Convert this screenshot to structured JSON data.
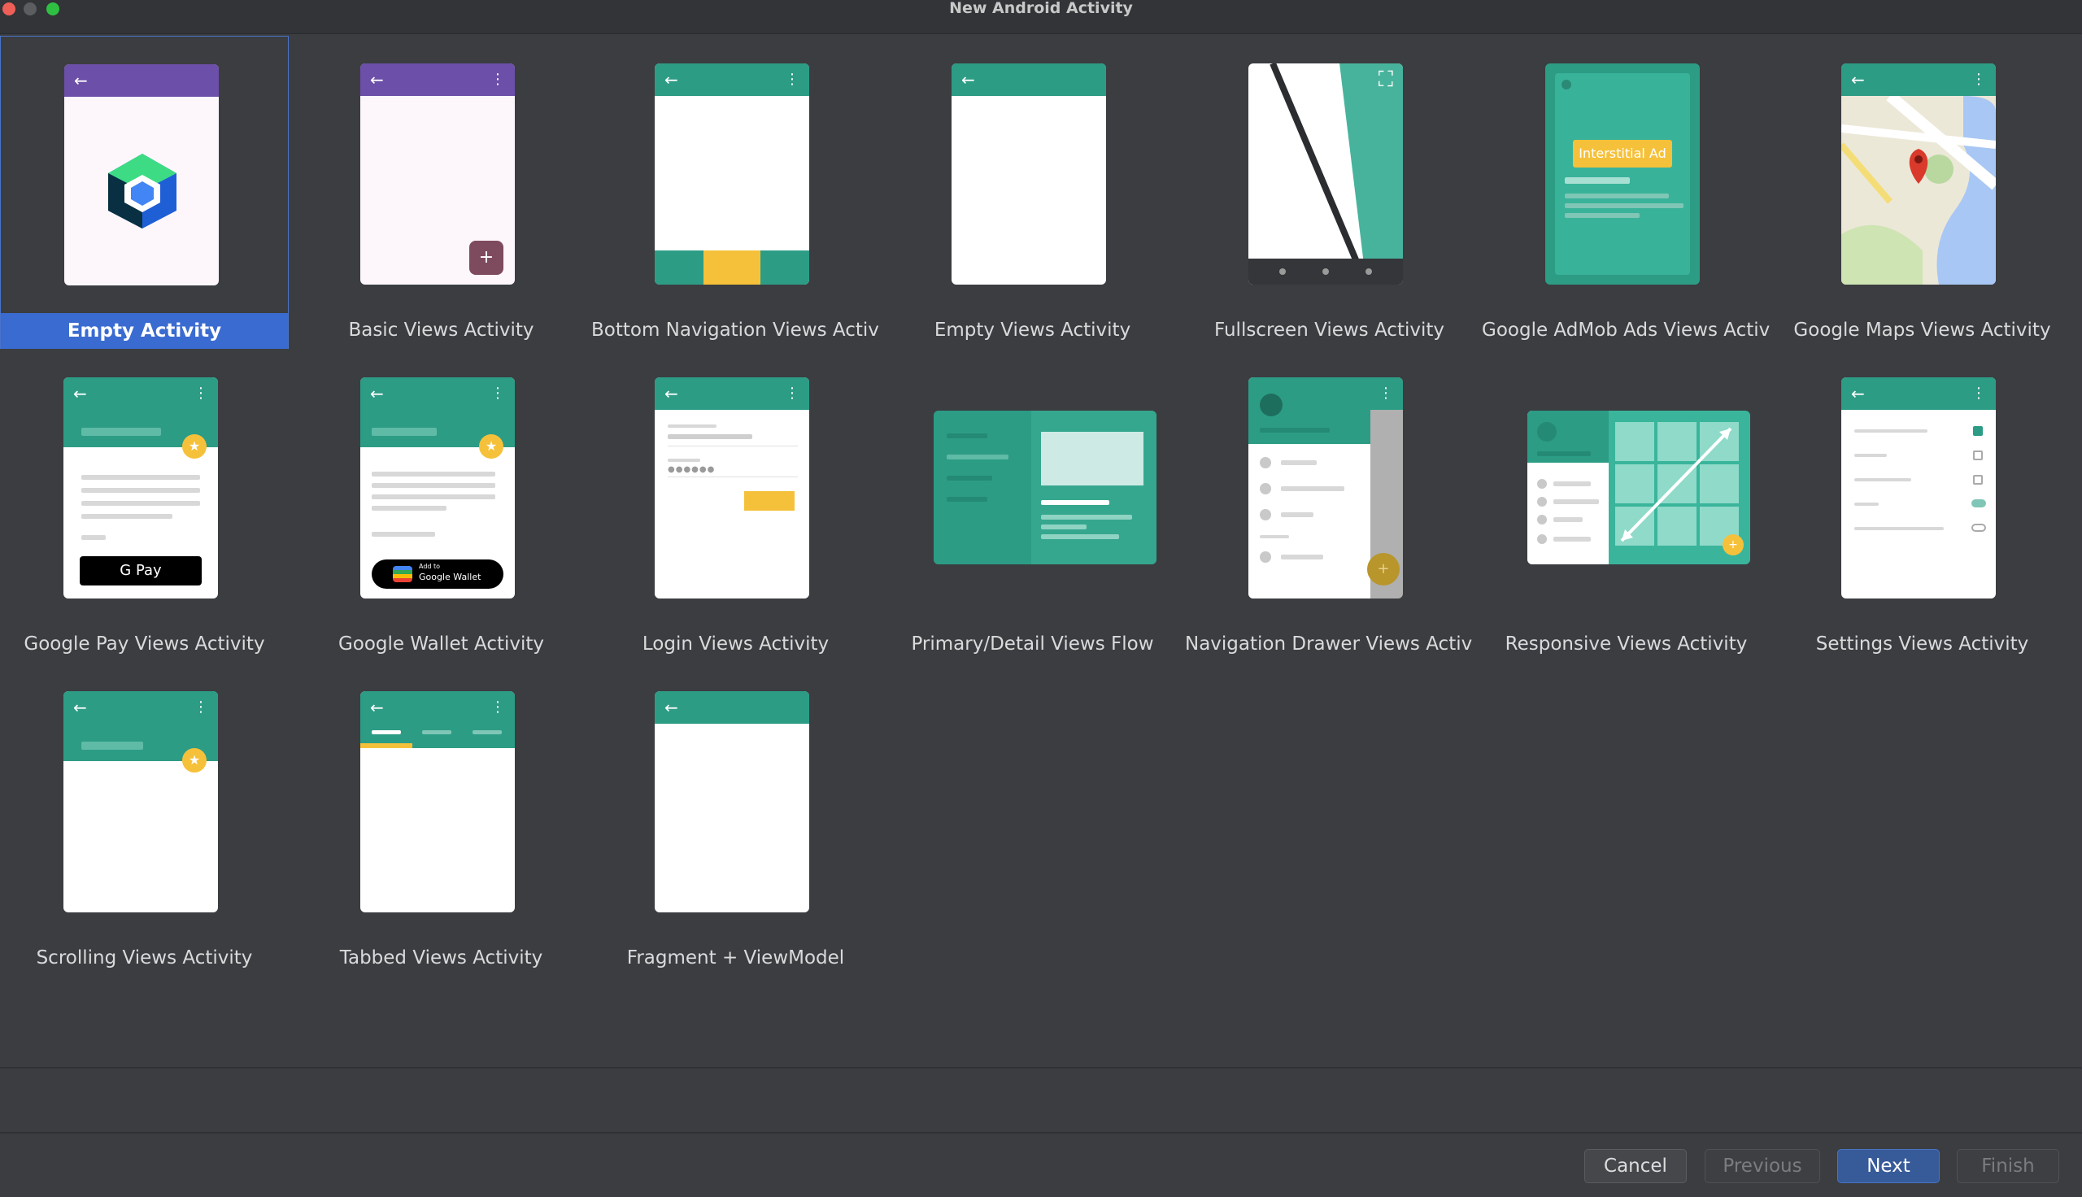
{
  "window": {
    "title": "New Android Activity"
  },
  "templates": [
    {
      "label": "Empty Activity",
      "selected": true
    },
    {
      "label": "Basic Views Activity"
    },
    {
      "label": "Bottom Navigation Views Activity"
    },
    {
      "label": "Empty Views Activity"
    },
    {
      "label": "Fullscreen Views Activity"
    },
    {
      "label": "Google AdMob Ads Views Activ..."
    },
    {
      "label": "Google Maps Views Activity"
    },
    {
      "label": "Google Pay Views Activity"
    },
    {
      "label": "Google Wallet Activity"
    },
    {
      "label": "Login Views Activity"
    },
    {
      "label": "Primary/Detail Views Flow"
    },
    {
      "label": "Navigation Drawer Views Activity"
    },
    {
      "label": "Responsive Views Activity"
    },
    {
      "label": "Settings Views Activity"
    },
    {
      "label": "Scrolling Views Activity"
    },
    {
      "label": "Tabbed Views Activity"
    },
    {
      "label": "Fragment + ViewModel"
    }
  ],
  "thumb_text": {
    "admob_badge": "Interstitial Ad",
    "gpay_button": "G Pay",
    "wallet_line1": "Add to",
    "wallet_line2": "Google Wallet"
  },
  "buttons": {
    "cancel": "Cancel",
    "previous": "Previous",
    "next": "Next",
    "finish": "Finish"
  },
  "colors": {
    "accent_teal": "#2d9c85",
    "accent_purple": "#6c4fa8",
    "selection": "#3a6bd0",
    "star": "#f6c13a"
  }
}
